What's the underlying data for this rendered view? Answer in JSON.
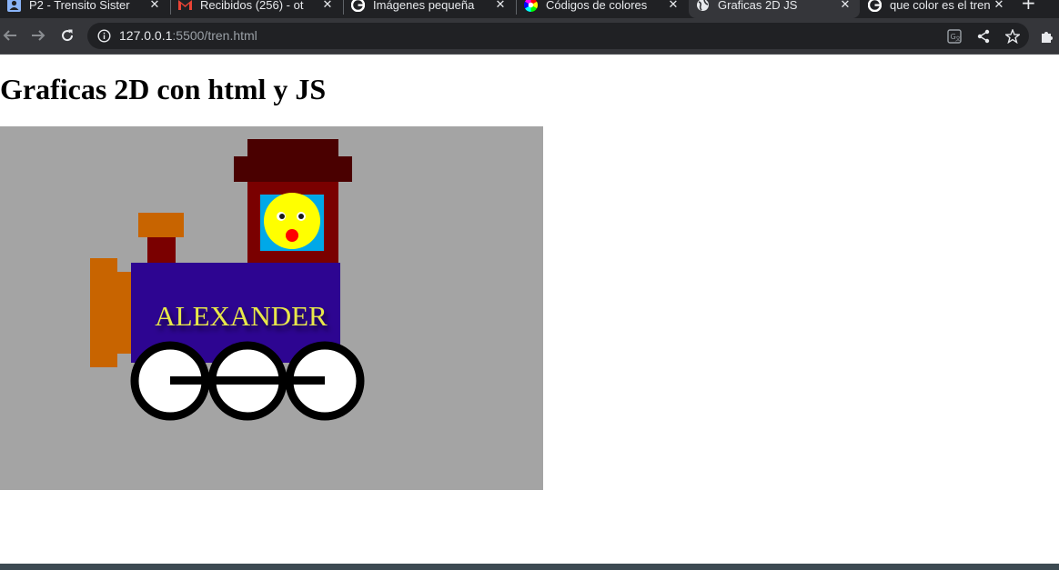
{
  "browser": {
    "tabs": [
      {
        "title": "P2 - Trensito Sister",
        "icon": "user-icon"
      },
      {
        "title": "Recibidos (256) - ot",
        "icon": "gmail-icon"
      },
      {
        "title": "Imágenes pequeña",
        "icon": "google-icon"
      },
      {
        "title": "Códigos de colores",
        "icon": "color-wheel-icon"
      },
      {
        "title": "Graficas 2D JS",
        "icon": "globe-icon",
        "active": true
      },
      {
        "title": "que color es el tren",
        "icon": "google-icon"
      }
    ],
    "new_tab_label": "+",
    "url_host": "127.0.0.1",
    "url_rest": ":5500/tren.html"
  },
  "page": {
    "heading": "Graficas 2D con html y JS"
  },
  "canvas": {
    "train_name": "ALEXANDER",
    "colors": {
      "background": "#a4a4a4",
      "body": "#2d0591",
      "cabin": "#7a0000",
      "roof": "#4a0000",
      "window": "#00a8e8",
      "face": "#ffff00",
      "nose": "#ff0000",
      "chimney": "#c86400",
      "bumper": "#c86400",
      "wheel_fill": "#ffffff",
      "wheel_stroke": "#000000",
      "name_text": "#e8e84a"
    }
  }
}
